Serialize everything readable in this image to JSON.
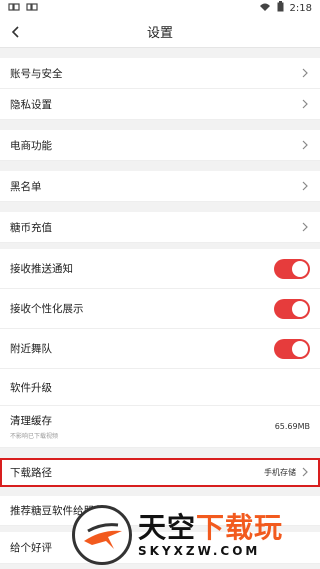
{
  "status": {
    "left_icons": [
      "notification-icon",
      "notification-icon"
    ],
    "time": "2:18"
  },
  "nav": {
    "title": "设置"
  },
  "rows": {
    "account": "账号与安全",
    "privacy": "隐私设置",
    "ecommerce": "电商功能",
    "blacklist": "黑名单",
    "recharge": "糖币充值",
    "push": "接收推送通知",
    "personal": "接收个性化展示",
    "nearby": "附近舞队",
    "upgrade": "软件升级",
    "cache": "清理缓存",
    "cache_sub": "不影响已下载视频",
    "cache_size": "65.69MB",
    "download": "下载路径",
    "download_value": "手机存储",
    "recommend": "推荐糖豆软件给朋友",
    "rate": "给个好评"
  },
  "toggles": {
    "push": true,
    "personal": true,
    "nearby": true
  },
  "watermark": {
    "big_left": "天空",
    "big_right": "下载玩",
    "small": "SKYXZW.COM"
  },
  "colors": {
    "accent": "#e63c3c",
    "highlight": "#d81e1e",
    "watermark_orange": "#f25a1e"
  }
}
